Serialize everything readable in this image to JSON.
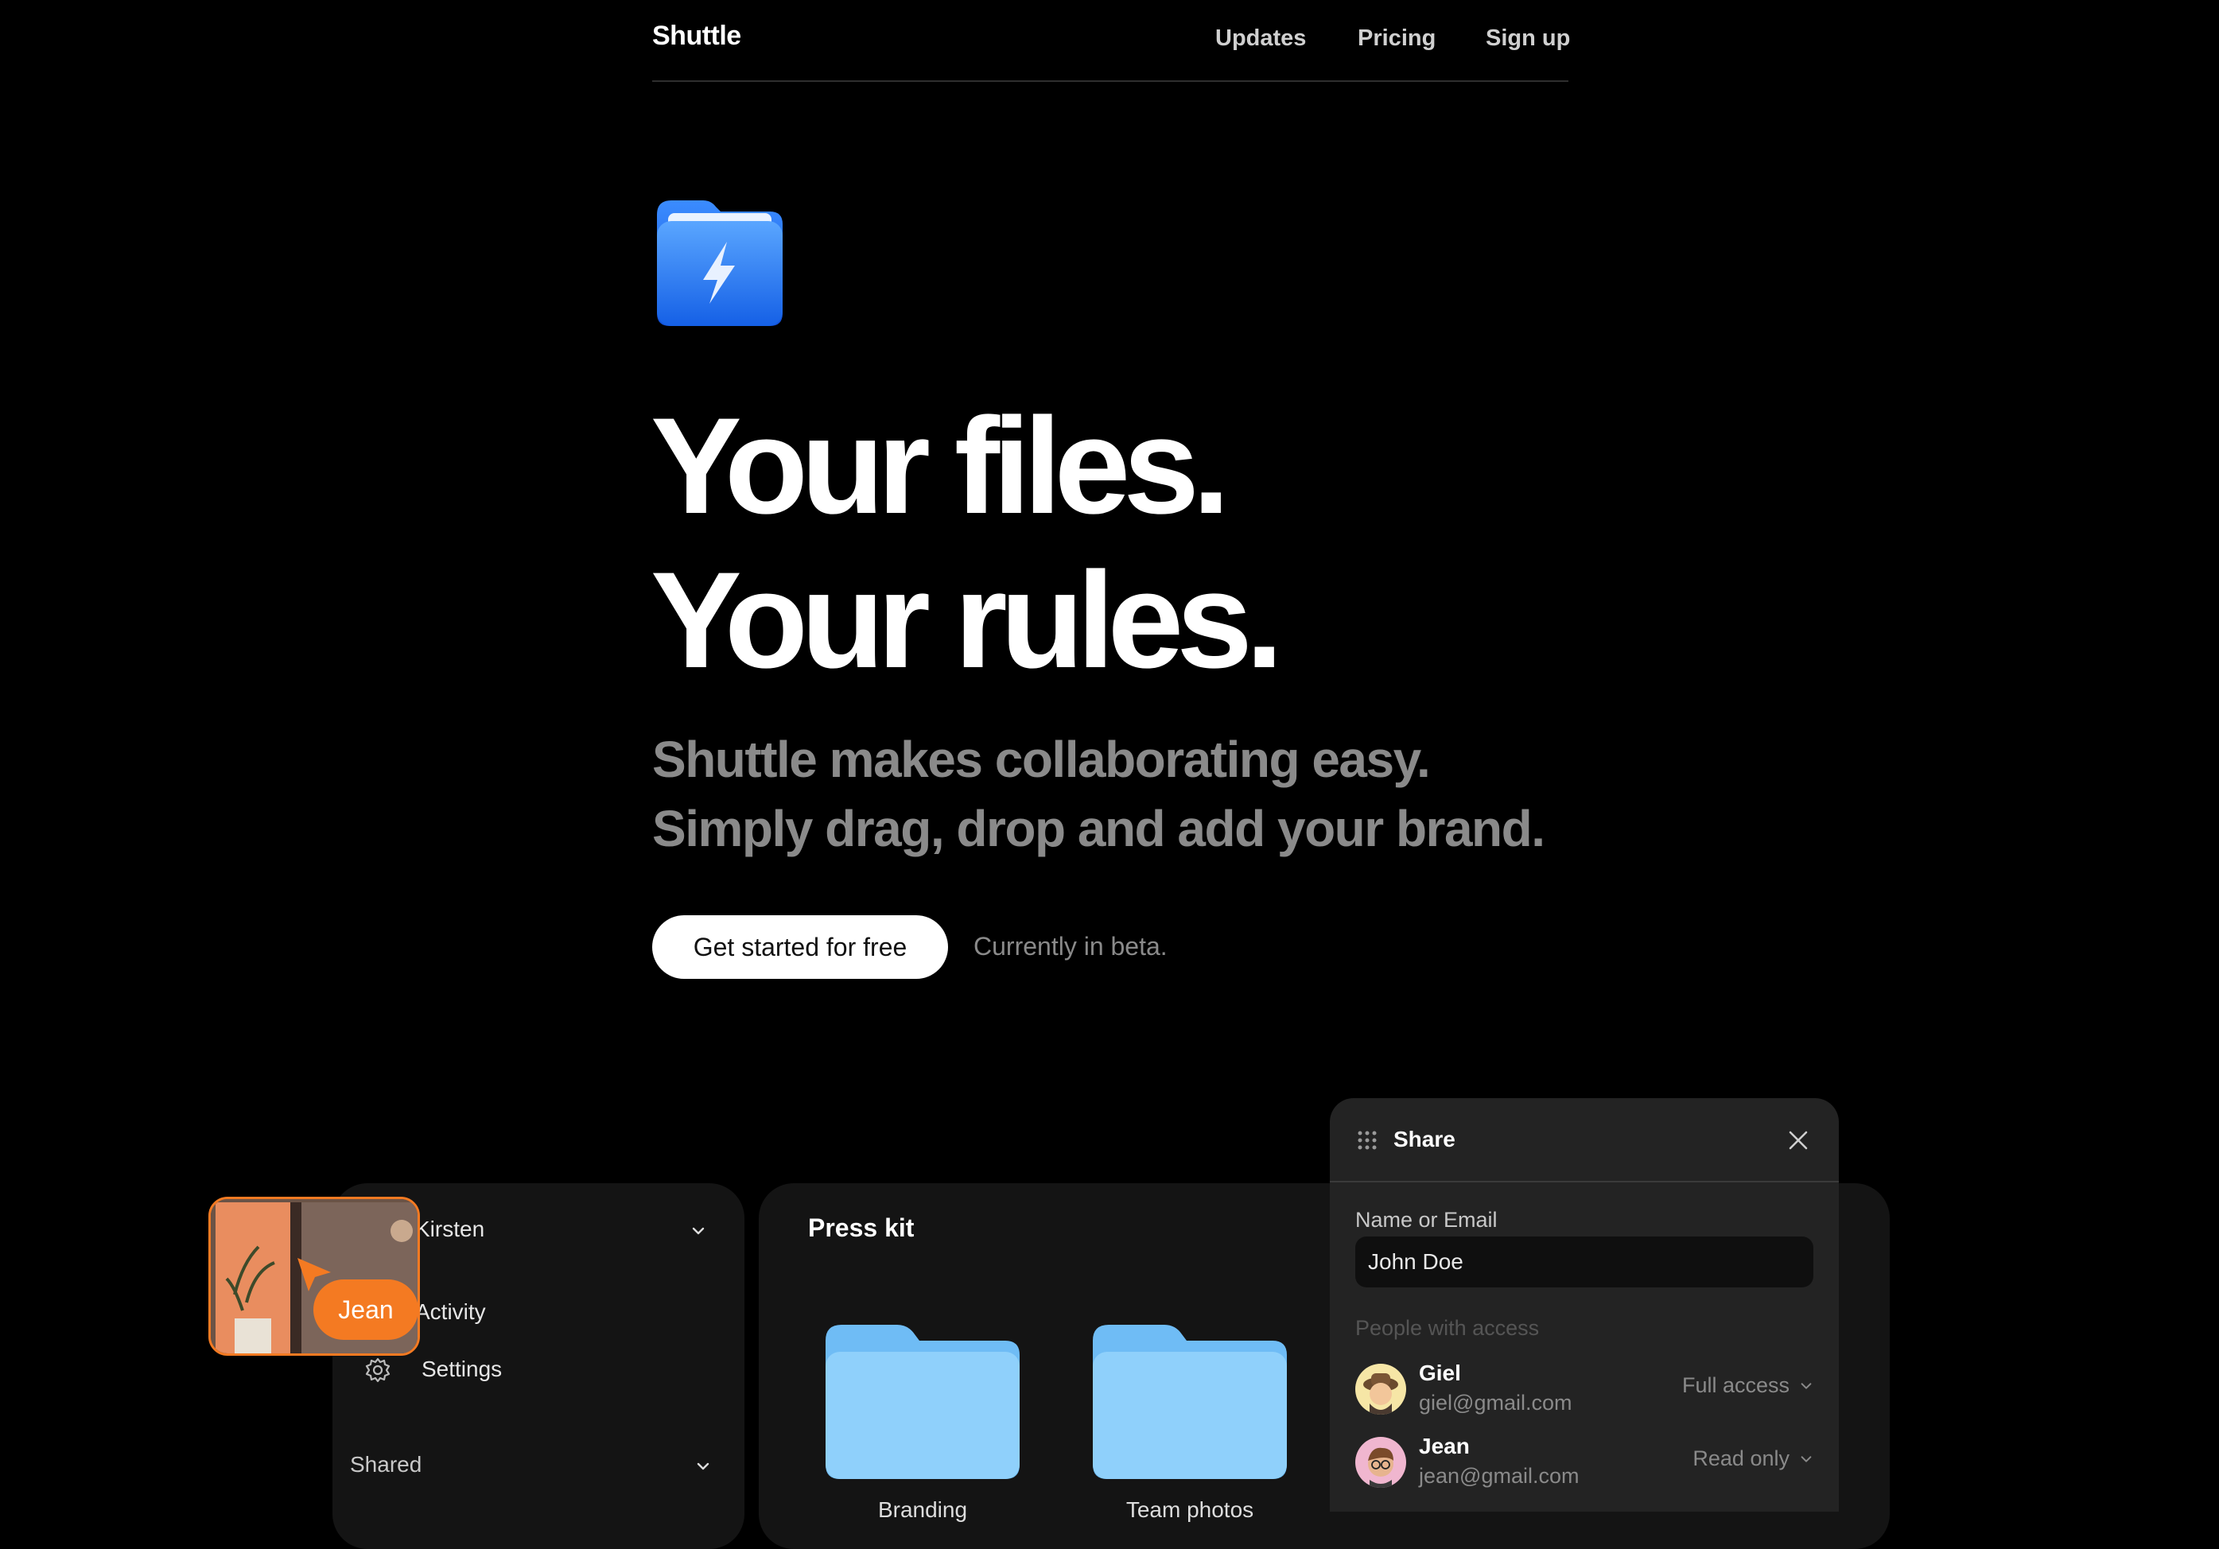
{
  "nav": {
    "brand": "Shuttle",
    "links": [
      "Updates",
      "Pricing",
      "Sign up"
    ]
  },
  "hero": {
    "headline_1": "Your files.",
    "headline_2": "Your rules.",
    "subline_1": "Shuttle makes collaborating easy.",
    "subline_2": "Simply drag, drop and add your brand.",
    "cta_label": "Get started for free",
    "beta_note": "Currently in beta."
  },
  "sidebar": {
    "account_name": "Kirsten",
    "items": [
      {
        "label": "Activity",
        "icon": "activity-icon"
      },
      {
        "label": "Settings",
        "icon": "gear-icon"
      }
    ],
    "section_label": "Shared"
  },
  "main": {
    "title": "Press kit",
    "folders": [
      "Branding",
      "Team photos"
    ]
  },
  "share_dialog": {
    "title": "Share",
    "field_label": "Name or Email",
    "field_value": "John Doe",
    "access_heading": "People with access",
    "people": [
      {
        "name": "Giel",
        "email": "giel@gmail.com",
        "access": "Full access"
      },
      {
        "name": "Jean",
        "email": "jean@gmail.com",
        "access": "Read only"
      }
    ]
  },
  "cursor_badge": {
    "label": "Jean"
  },
  "colors": {
    "background": "#000000",
    "accent": "#f47a22",
    "folder_blue": "#8fd0fb",
    "logo_blue": "#1a6ff2"
  }
}
